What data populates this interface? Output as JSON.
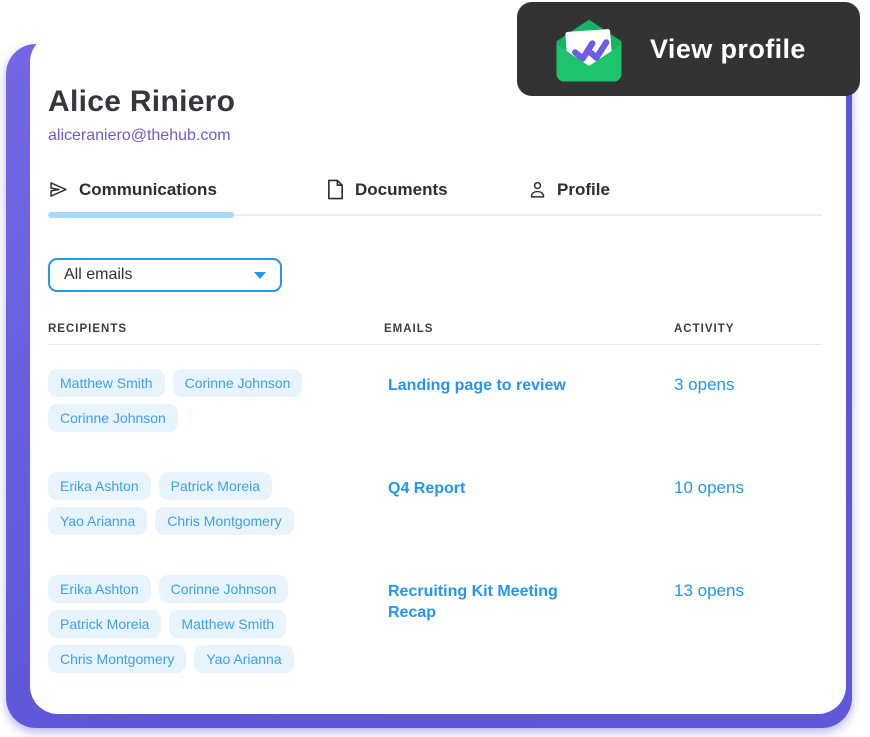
{
  "badge": {
    "label": "View profile"
  },
  "profile": {
    "name": "Alice Riniero",
    "email": "aliceraniero@thehub.com"
  },
  "tabs": [
    {
      "label": "Communications",
      "icon": "send-icon",
      "active": true
    },
    {
      "label": "Documents",
      "icon": "document-icon",
      "active": false
    },
    {
      "label": "Profile",
      "icon": "person-icon",
      "active": false
    }
  ],
  "filter": {
    "value": "All emails"
  },
  "table": {
    "headers": [
      "RECIPIENTS",
      "EMAILS",
      "ACTIVITY"
    ],
    "rows": [
      {
        "recipients": [
          "Matthew Smith",
          "Corinne Johnson",
          "Corinne Johnson"
        ],
        "email": "Landing page to review",
        "activity": "3 opens"
      },
      {
        "recipients": [
          "Erika Ashton",
          "Patrick Moreia",
          "Yao Arianna",
          "Chris Montgomery"
        ],
        "email": "Q4 Report",
        "activity": "10 opens"
      },
      {
        "recipients": [
          "Erika Ashton",
          "Corinne Johnson",
          "Patrick Moreia",
          "Matthew Smith",
          "Chris Montgomery",
          "Yao Arianna"
        ],
        "email": "Recruiting Kit Meeting Recap",
        "activity": "13 opens"
      }
    ]
  },
  "colors": {
    "accent_blue": "#2196f3",
    "chip_bg": "#e8f4fd",
    "chip_text": "#3b9ff3",
    "purple_backdrop": "#5f58d8",
    "purple_link": "#6a5ae0",
    "badge_bg": "#333333",
    "envelope_green": "#1ec36e",
    "check_purple": "#6e5be6",
    "active_tab_underline": "#a6d9f5"
  }
}
